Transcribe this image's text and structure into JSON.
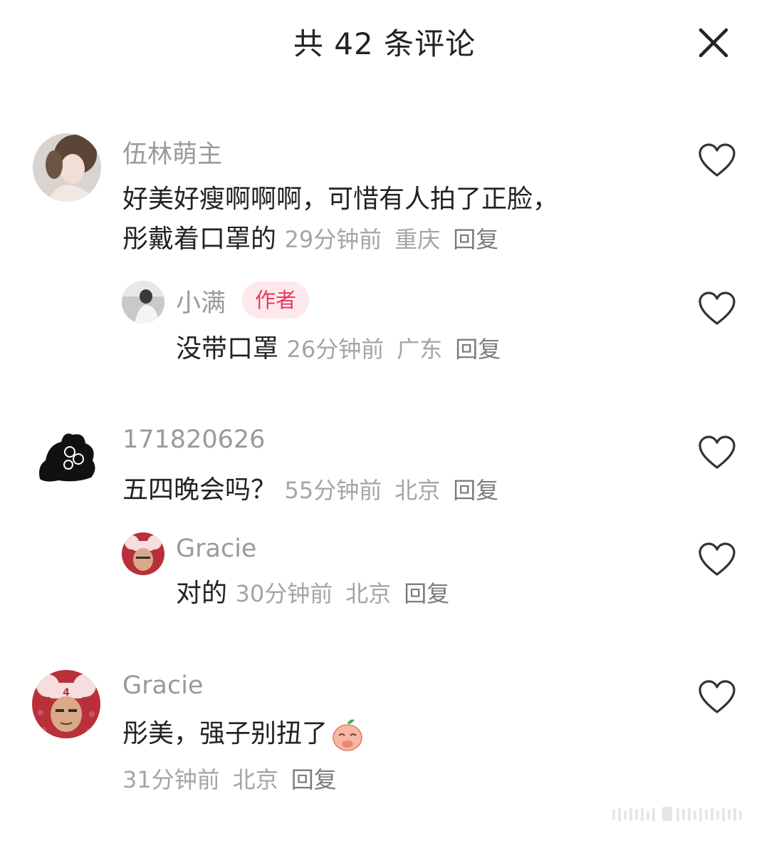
{
  "header": {
    "title": "共 42 条评论"
  },
  "comments": [
    {
      "username": "伍林萌主",
      "text_line1": "好美好瘦啊啊啊，可惜有人拍了正脸，",
      "text_line2": "彤戴着口罩的",
      "time": "29分钟前",
      "location": "重庆",
      "reply_label": "回复",
      "replies": [
        {
          "username": "小满",
          "badge": "作者",
          "text": "没带口罩",
          "time": "26分钟前",
          "location": "广东",
          "reply_label": "回复"
        }
      ]
    },
    {
      "username": "171820626",
      "text": "五四晚会吗？",
      "time": "55分钟前",
      "location": "北京",
      "reply_label": "回复",
      "replies": [
        {
          "username": "Gracie",
          "text": "对的",
          "time": "30分钟前",
          "location": "北京",
          "reply_label": "回复"
        }
      ]
    },
    {
      "username": "Gracie",
      "text": "彤美，强子别扭了",
      "emoji": "peach-emoji",
      "time": "31分钟前",
      "location": "北京",
      "reply_label": "回复"
    }
  ],
  "colors": {
    "badge_bg": "#fde8ec",
    "badge_text": "#e83a5c",
    "meta": "#a5a5a5",
    "username": "#9a9a9a"
  },
  "icons": [
    "close-icon",
    "heart-outline-icon",
    "peach-emoji"
  ]
}
